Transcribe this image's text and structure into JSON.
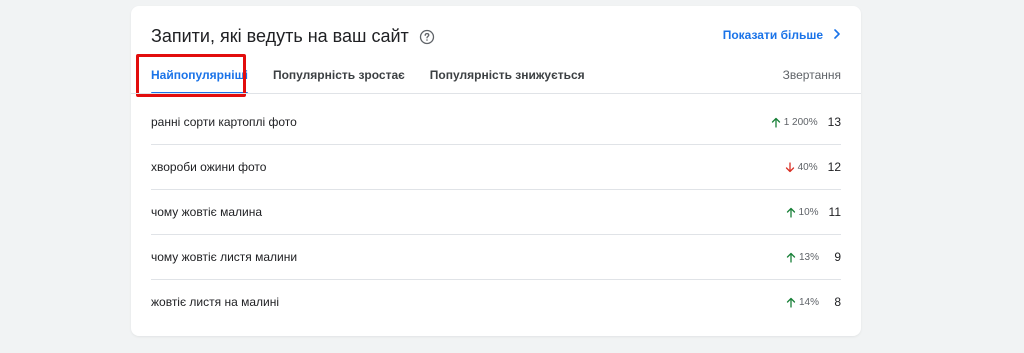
{
  "card": {
    "title": "Запити, які ведуть на ваш сайт",
    "show_more": "Показати більше"
  },
  "tabs": [
    {
      "label": "Найпопулярніші",
      "active": true
    },
    {
      "label": "Популярність зростає",
      "active": false
    },
    {
      "label": "Популярність знижується",
      "active": false
    }
  ],
  "column_header": "Звертання",
  "rows": [
    {
      "query": "ранні сорти картоплі фото",
      "direction": "up",
      "change": "1 200%",
      "count": "13"
    },
    {
      "query": "хвороби ожини фото",
      "direction": "down",
      "change": "40%",
      "count": "12"
    },
    {
      "query": "чому жовтіє малина",
      "direction": "up",
      "change": "10%",
      "count": "11"
    },
    {
      "query": "чому жовтіє листя малини",
      "direction": "up",
      "change": "13%",
      "count": "9"
    },
    {
      "query": "жовтіє листя на малині",
      "direction": "up",
      "change": "14%",
      "count": "8"
    }
  ],
  "colors": {
    "accent": "#1a73e8",
    "up_arrow": "#188038",
    "down_arrow": "#d93025",
    "highlight": "#e20d0d"
  }
}
